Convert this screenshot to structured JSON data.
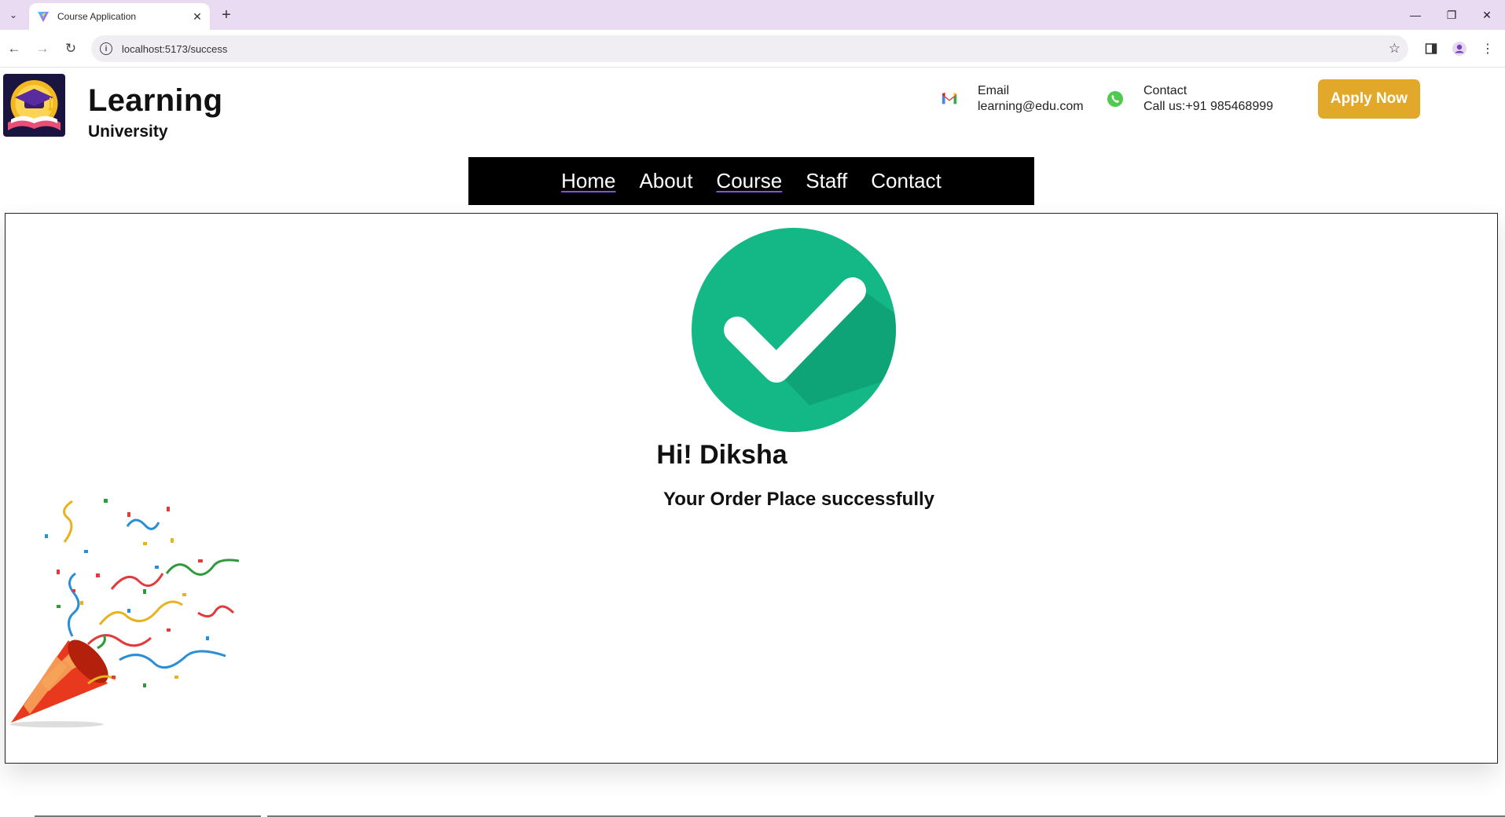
{
  "browser": {
    "tab_title": "Course Application",
    "url": "localhost:5173/success"
  },
  "header": {
    "brand_title": "Learning",
    "brand_subtitle": "University",
    "email_label": "Email",
    "email_value": "learning@edu.com",
    "contact_label": "Contact",
    "contact_value": "Call us:+91 985468999",
    "apply_label": "Apply Now",
    "accent_color": "#e2a82a"
  },
  "nav": {
    "items": [
      {
        "label": "Home"
      },
      {
        "label": "About"
      },
      {
        "label": "Course"
      },
      {
        "label": "Staff"
      },
      {
        "label": "Contact"
      }
    ]
  },
  "main": {
    "greeting": "Hi! Diksha",
    "message": "Your Order Place successfully",
    "check_color": "#13b886",
    "icons": [
      "check-circle-icon",
      "party-popper-icon"
    ]
  }
}
